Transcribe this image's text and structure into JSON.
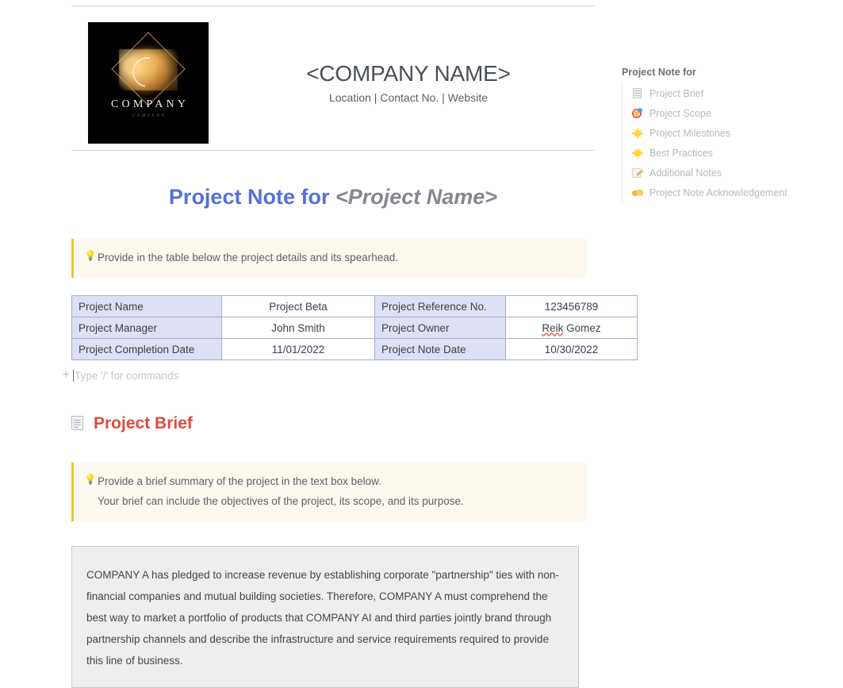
{
  "header": {
    "logo": {
      "brand_name": "COMPANY",
      "tagline": "COMPANY"
    },
    "company_name": "<COMPANY NAME>",
    "company_meta": "Location | Contact No. | Website"
  },
  "page_title": {
    "prefix": "Project Note for ",
    "placeholder": "<Project Name>"
  },
  "callout_top": {
    "icon": "lightbulb-icon",
    "line1": "Provide in the table below the project details and its spearhead."
  },
  "table": {
    "rows": [
      {
        "label1": "Project Name",
        "value1": "Project Beta",
        "label2": "Project Reference No.",
        "value2": "123456789"
      },
      {
        "label1": "Project Manager",
        "value1": "John Smith",
        "label2": "Project Owner",
        "value2_misspelled": "Reik",
        "value2_rest": " Gomez"
      },
      {
        "label1": "Project Completion Date",
        "value1": "11/01/2022",
        "label2": "Project Note Date",
        "value2": "10/30/2022"
      }
    ]
  },
  "command_line": {
    "add_label": "+",
    "placeholder": "Type '/' for commands"
  },
  "section": {
    "icon": "document-icon",
    "title": "Project Brief",
    "callout": {
      "icon": "lightbulb-icon",
      "line1": "Provide a brief summary of the project in the text box below.",
      "line2": "Your brief can include the objectives of the project, its scope, and its purpose."
    },
    "body": "COMPANY A has pledged to increase revenue by establishing corporate \"partnership\" ties with non-financial companies and mutual building societies. Therefore, COMPANY A must comprehend the best way to market a portfolio of products that COMPANY AI and third parties jointly brand through partnership channels and describe the infrastructure and service requirements required to provide this line of business."
  },
  "toc": {
    "title": "Project Note for",
    "items": [
      {
        "label": "Project Brief",
        "icon": "page-icon"
      },
      {
        "label": "Project Scope",
        "icon": "target-icon"
      },
      {
        "label": "Project Milestones",
        "icon": "sparkle-icon"
      },
      {
        "label": "Best Practices",
        "icon": "sparkle-icon"
      },
      {
        "label": "Additional Notes",
        "icon": "memo-icon"
      },
      {
        "label": "Project Note Acknowledgement",
        "icon": "handshake-icon"
      }
    ]
  },
  "colors": {
    "title_accent": "#5570d8",
    "title_placeholder": "#84878f",
    "section_accent": "#e04a3c",
    "callout_bar": "#f0c040",
    "callout_bg": "#fdf9ee",
    "table_label_bg": "#dde1f3",
    "table_border": "#a9aed0",
    "textbox_bg": "#eeeeee"
  }
}
